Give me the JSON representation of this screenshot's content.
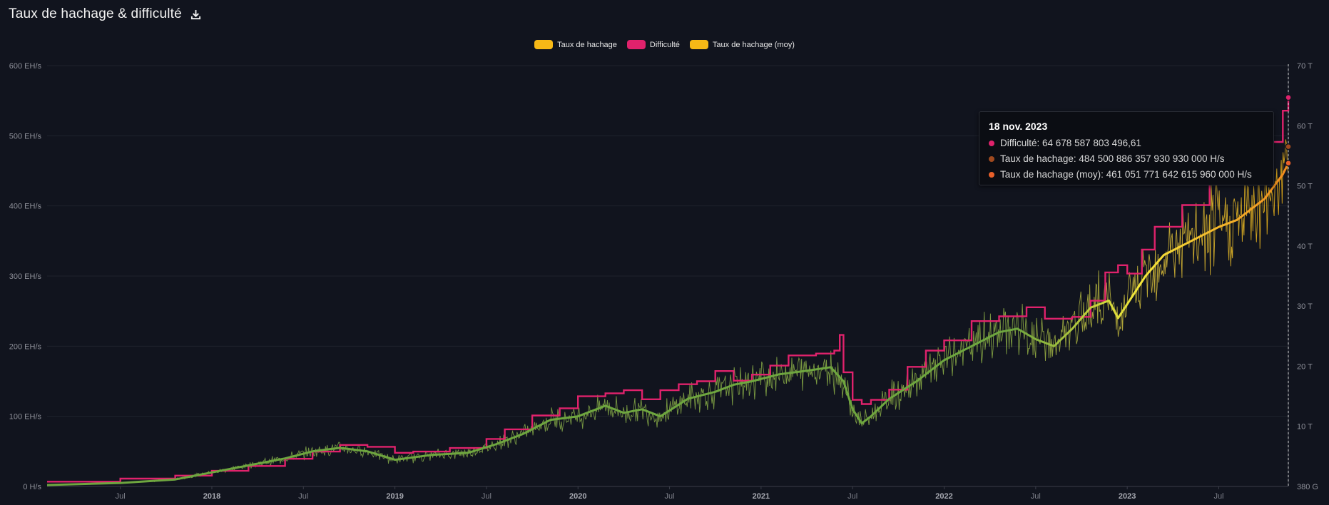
{
  "header": {
    "title": "Taux de hachage & difficulté",
    "download_icon": "download-icon"
  },
  "legend": [
    {
      "label": "Taux de hachage",
      "color": "#f7b916"
    },
    {
      "label": "Difficulté",
      "color": "#e0226c"
    },
    {
      "label": "Taux de hachage (moy)",
      "color": "#f7b916"
    }
  ],
  "tooltip": {
    "date": "18 nov. 2023",
    "rows": [
      {
        "text": "Difficulté: 64 678 587 803 496,61",
        "color": "#e0226c"
      },
      {
        "text": "Taux de hachage: 484 500 886 357 930 930 000 H/s",
        "color": "#a04a1f"
      },
      {
        "text": "Taux de hachage (moy): 461 051 771 642 615 960 000 H/s",
        "color": "#e9602a"
      }
    ]
  },
  "chart_data": {
    "type": "line",
    "title": "Taux de hachage & difficulté",
    "y_left": {
      "ticks": [
        "0 H/s",
        "100 EH/s",
        "200 EH/s",
        "300 EH/s",
        "400 EH/s",
        "500 EH/s",
        "600 EH/s"
      ],
      "range_ehs": [
        0,
        600
      ]
    },
    "y_right": {
      "ticks": [
        "380 G",
        "10 T",
        "20 T",
        "30 T",
        "40 T",
        "50 T",
        "60 T",
        "70 T"
      ],
      "range_t": [
        0.38,
        70
      ]
    },
    "x_ticks": [
      {
        "label": "Jul",
        "date": 2017.5,
        "bold": false
      },
      {
        "label": "2018",
        "date": 2018.0,
        "bold": true
      },
      {
        "label": "Jul",
        "date": 2018.5,
        "bold": false
      },
      {
        "label": "2019",
        "date": 2019.0,
        "bold": true
      },
      {
        "label": "Jul",
        "date": 2019.5,
        "bold": false
      },
      {
        "label": "2020",
        "date": 2020.0,
        "bold": true
      },
      {
        "label": "Jul",
        "date": 2020.5,
        "bold": false
      },
      {
        "label": "2021",
        "date": 2021.0,
        "bold": true
      },
      {
        "label": "Jul",
        "date": 2021.5,
        "bold": false
      },
      {
        "label": "2022",
        "date": 2022.0,
        "bold": true
      },
      {
        "label": "Jul",
        "date": 2022.5,
        "bold": false
      },
      {
        "label": "2023",
        "date": 2023.0,
        "bold": true
      },
      {
        "label": "Jul",
        "date": 2023.5,
        "bold": false
      }
    ],
    "x_range": [
      2017.1,
      2023.88
    ],
    "crosshair_date": 2023.88,
    "series": [
      {
        "name": "Difficulté",
        "color": "#e0226c",
        "unit": "T",
        "points": [
          [
            2017.1,
            0.8
          ],
          [
            2017.5,
            1.3
          ],
          [
            2017.8,
            1.8
          ],
          [
            2018.0,
            2.6
          ],
          [
            2018.2,
            3.4
          ],
          [
            2018.4,
            4.6
          ],
          [
            2018.55,
            5.8
          ],
          [
            2018.7,
            6.9
          ],
          [
            2018.85,
            6.6
          ],
          [
            2019.0,
            5.6
          ],
          [
            2019.1,
            5.8
          ],
          [
            2019.3,
            6.4
          ],
          [
            2019.5,
            7.9
          ],
          [
            2019.6,
            9.5
          ],
          [
            2019.75,
            11.8
          ],
          [
            2019.9,
            13.0
          ],
          [
            2020.0,
            15.0
          ],
          [
            2020.15,
            15.5
          ],
          [
            2020.25,
            16.0
          ],
          [
            2020.35,
            14.5
          ],
          [
            2020.45,
            16.0
          ],
          [
            2020.55,
            17.0
          ],
          [
            2020.65,
            17.5
          ],
          [
            2020.75,
            19.2
          ],
          [
            2020.85,
            17.6
          ],
          [
            2020.95,
            18.6
          ],
          [
            2021.05,
            20.1
          ],
          [
            2021.15,
            21.8
          ],
          [
            2021.3,
            22.1
          ],
          [
            2021.4,
            22.6
          ],
          [
            2021.43,
            25.2
          ],
          [
            2021.45,
            19.0
          ],
          [
            2021.5,
            14.4
          ],
          [
            2021.55,
            13.7
          ],
          [
            2021.6,
            14.4
          ],
          [
            2021.7,
            16.1
          ],
          [
            2021.8,
            19.9
          ],
          [
            2021.9,
            22.6
          ],
          [
            2022.0,
            24.3
          ],
          [
            2022.15,
            27.5
          ],
          [
            2022.3,
            28.3
          ],
          [
            2022.45,
            29.8
          ],
          [
            2022.55,
            27.9
          ],
          [
            2022.7,
            28.2
          ],
          [
            2022.8,
            30.9
          ],
          [
            2022.88,
            35.6
          ],
          [
            2022.95,
            36.8
          ],
          [
            2023.0,
            35.4
          ],
          [
            2023.08,
            39.4
          ],
          [
            2023.15,
            43.2
          ],
          [
            2023.3,
            46.8
          ],
          [
            2023.45,
            52.4
          ],
          [
            2023.6,
            54.1
          ],
          [
            2023.75,
            57.3
          ],
          [
            2023.85,
            62.5
          ],
          [
            2023.88,
            64.7
          ]
        ]
      },
      {
        "name": "Taux de hachage (moy)",
        "color_start": "#6ea63f",
        "color_mid": "#f5e83a",
        "color_end": "#f28a1e",
        "unit": "EH/s",
        "points": [
          [
            2017.1,
            2
          ],
          [
            2017.5,
            5
          ],
          [
            2017.8,
            10
          ],
          [
            2018.0,
            20
          ],
          [
            2018.2,
            30
          ],
          [
            2018.4,
            40
          ],
          [
            2018.55,
            50
          ],
          [
            2018.7,
            55
          ],
          [
            2018.85,
            50
          ],
          [
            2019.0,
            38
          ],
          [
            2019.2,
            45
          ],
          [
            2019.4,
            48
          ],
          [
            2019.55,
            60
          ],
          [
            2019.7,
            75
          ],
          [
            2019.85,
            95
          ],
          [
            2020.0,
            100
          ],
          [
            2020.15,
            115
          ],
          [
            2020.25,
            105
          ],
          [
            2020.35,
            110
          ],
          [
            2020.45,
            100
          ],
          [
            2020.6,
            125
          ],
          [
            2020.75,
            135
          ],
          [
            2020.85,
            145
          ],
          [
            2020.95,
            150
          ],
          [
            2021.1,
            160
          ],
          [
            2021.25,
            165
          ],
          [
            2021.38,
            170
          ],
          [
            2021.45,
            150
          ],
          [
            2021.5,
            110
          ],
          [
            2021.55,
            90
          ],
          [
            2021.6,
            100
          ],
          [
            2021.7,
            125
          ],
          [
            2021.85,
            150
          ],
          [
            2022.0,
            180
          ],
          [
            2022.15,
            200
          ],
          [
            2022.3,
            220
          ],
          [
            2022.4,
            225
          ],
          [
            2022.5,
            210
          ],
          [
            2022.6,
            200
          ],
          [
            2022.7,
            225
          ],
          [
            2022.8,
            255
          ],
          [
            2022.9,
            265
          ],
          [
            2022.95,
            240
          ],
          [
            2023.0,
            260
          ],
          [
            2023.1,
            300
          ],
          [
            2023.2,
            330
          ],
          [
            2023.35,
            350
          ],
          [
            2023.5,
            370
          ],
          [
            2023.6,
            380
          ],
          [
            2023.75,
            410
          ],
          [
            2023.85,
            445
          ],
          [
            2023.88,
            461
          ]
        ]
      },
      {
        "name": "Taux de hachage",
        "color": "#f7b916",
        "unit": "EH/s",
        "noise": true
      }
    ]
  }
}
